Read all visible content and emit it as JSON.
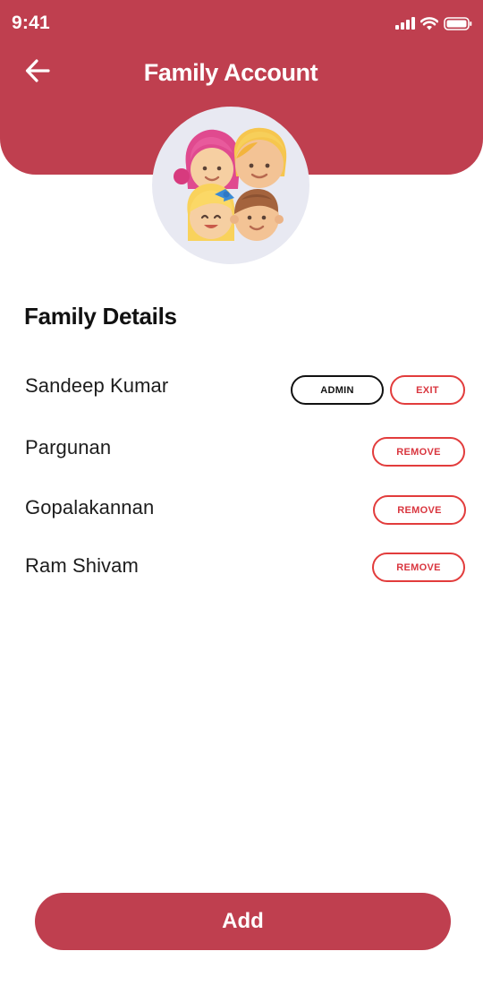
{
  "status_bar": {
    "time": "9:41"
  },
  "header": {
    "title": "Family Account",
    "back_icon": "arrow-left-icon",
    "background_color": "#bf3f4f"
  },
  "avatar": {
    "icon": "family-avatar-illustration"
  },
  "section": {
    "title": "Family Details"
  },
  "members": [
    {
      "name": "Sandeep Kumar",
      "badge_label": "ADMIN",
      "action_label": "EXIT"
    },
    {
      "name": "Pargunan",
      "action_label": "REMOVE"
    },
    {
      "name": "Gopalakannan",
      "action_label": "REMOVE"
    },
    {
      "name": "Ram Shivam",
      "action_label": "REMOVE"
    }
  ],
  "footer": {
    "add_label": "Add"
  },
  "colors": {
    "primary": "#bf3f4f",
    "danger_outline": "#e23c3c"
  }
}
